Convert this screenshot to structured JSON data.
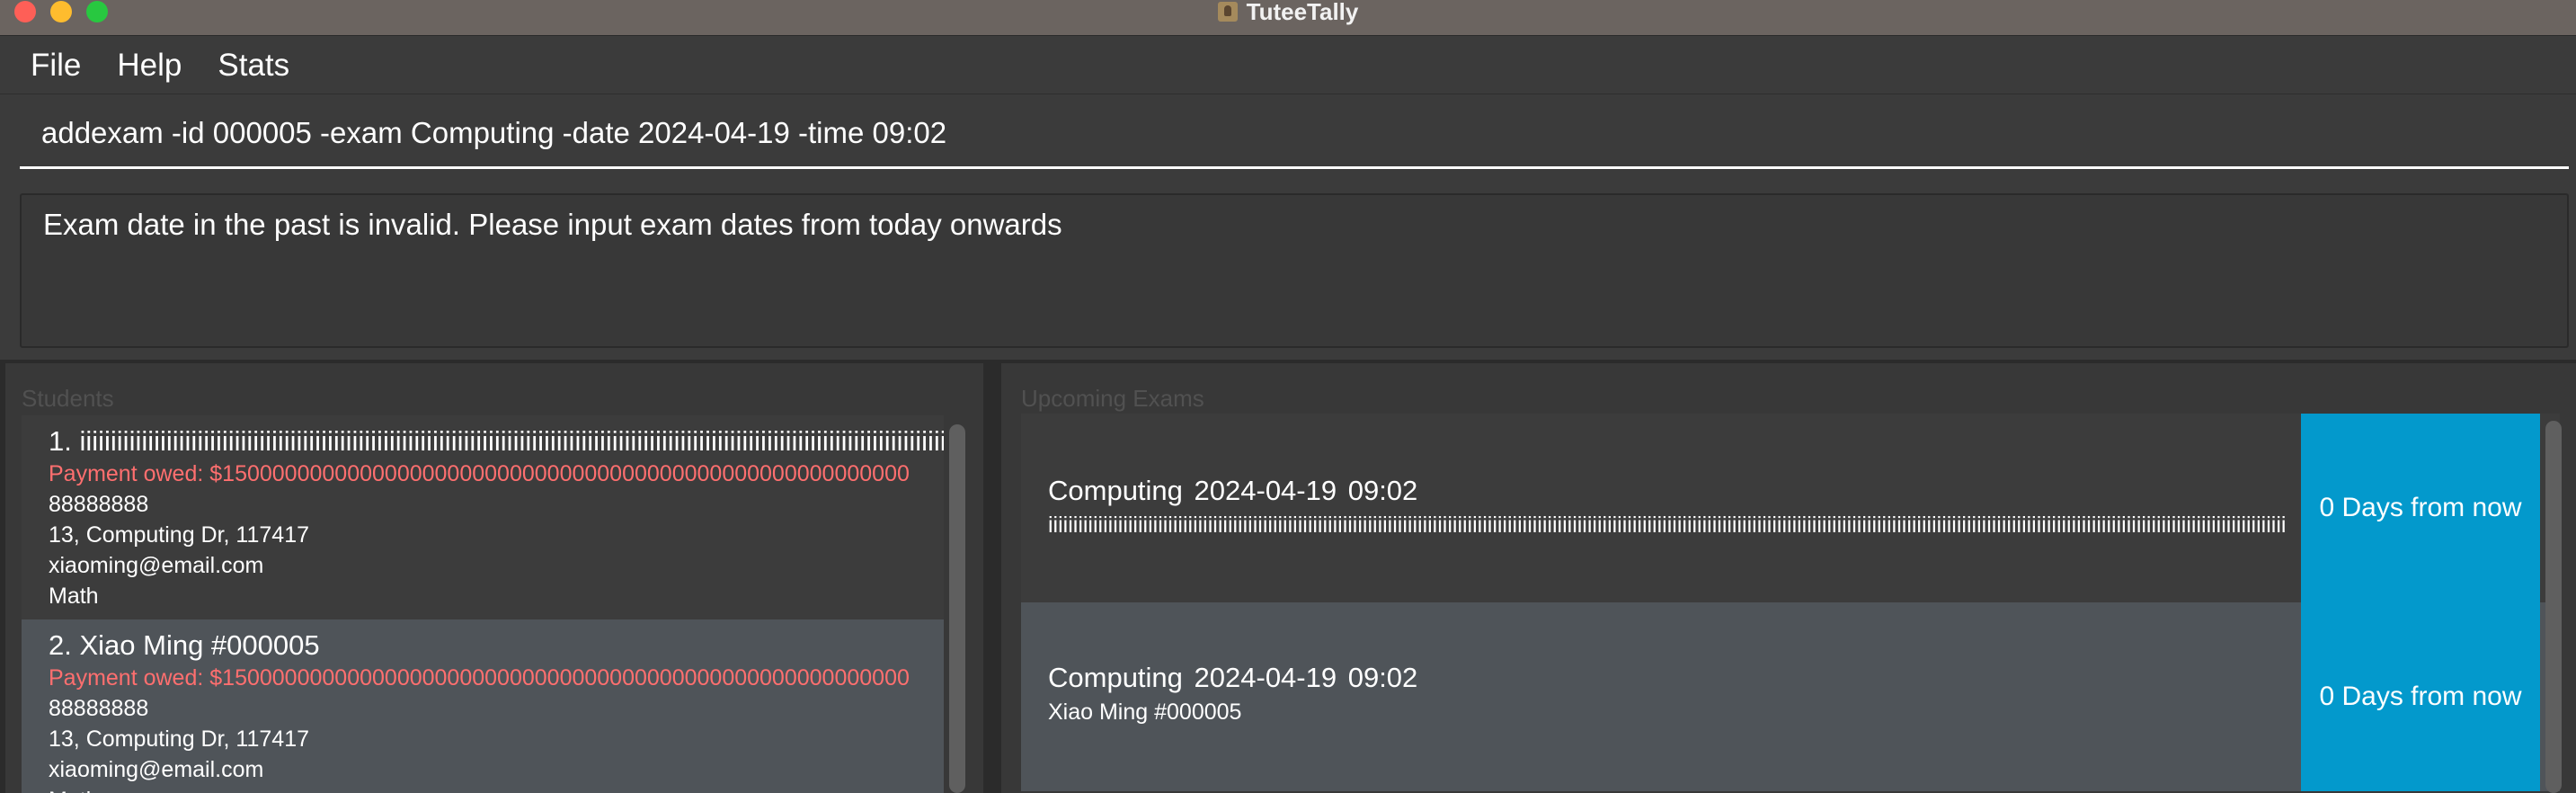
{
  "window": {
    "title": "TuteeTally"
  },
  "menu": [
    "File",
    "Help",
    "Stats"
  ],
  "command": {
    "value": "addexam -id 000005 -exam Computing -date 2024-04-19 -time 09:02"
  },
  "result": {
    "message": "Exam date in the past is invalid. Please input exam dates from today onwards"
  },
  "students": {
    "label": "Students",
    "items": [
      {
        "header": "1.  iiiiiiiiiiiiiiiiiiiiiiiiiiiiiiiiiiiiiiiiiiiiiiiiiiiiiiiiiiiiiiiiiiiiiiiiiiiiiiiiiiiiiiiiiiiiiiiiiiiiiiiiiiiiiiiiiiiiiiiiiiiiiiiiiiiiiiiiiiiiiiiiiiiiiiiiiiiiiiiiiiii",
        "payment": "Payment owed: $1500000000000000000000000000000000000000000000000000000",
        "phone": "88888888",
        "address": "13, Computing Dr, 117417",
        "email": "xiaoming@email.com",
        "subject": "Math"
      },
      {
        "header": "2.  Xiao Ming   #000005",
        "payment": "Payment owed: $1500000000000000000000000000000000000000000000000000000",
        "phone": "88888888",
        "address": "13, Computing Dr, 117417",
        "email": "xiaoming@email.com",
        "subject": "Math"
      }
    ]
  },
  "exams": {
    "label": "Upcoming Exams",
    "items": [
      {
        "title": "Computing  2024-04-19  09:02",
        "student": "iiiiiiiiiiiiiiiiiiiiiiiiiiiiiiiiiiiiiiiiiiiiiiiiiiiiiiiiiiiiiiiiiiiiiiiiiiiiiiiiiiiiiiiiiiiiiiiiiiiiiiiiiiiiiiiiiiiiiiiiiiiiiiiiiiiiiiiiiiiiiiiiiiiiiiiiiiiiiiiiiiiiiiiiiiiiiiiiiiiiiiiiiiiiiiiiiiiiiiiiiiiiiiiiiiiiiiiiiiiiiiiiiiiiiiiiiiiiiiiiiiiiiiii",
        "days": "0 Days from now"
      },
      {
        "title": "Computing  2024-04-19  09:02",
        "student": "Xiao Ming   #000005",
        "days": "0 Days from now"
      }
    ]
  },
  "colors": {
    "titlebar": "#6b6460",
    "background": "#3b3b3b",
    "payment": "#ff6f6f",
    "days_badge": "#0399cc",
    "card_alt": "#4f5459"
  }
}
